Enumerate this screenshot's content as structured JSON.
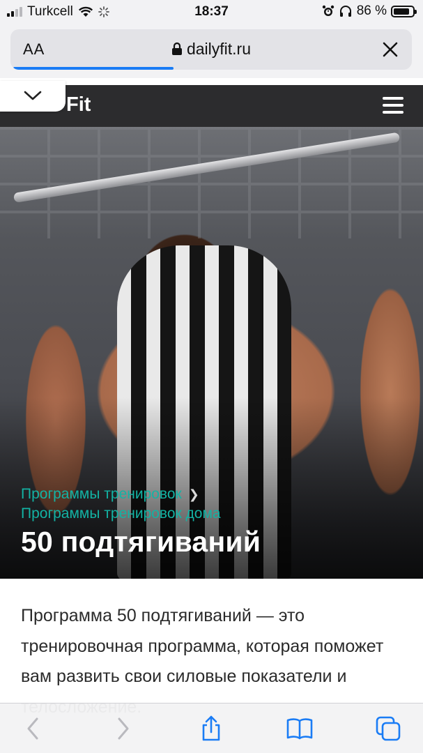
{
  "status_bar": {
    "carrier": "Turkcell",
    "time": "18:37",
    "battery_percent": "86 %",
    "battery_level": 0.86
  },
  "address_bar": {
    "text_size_label": "AA",
    "url": "dailyfit.ru",
    "load_progress": 0.4
  },
  "site_header": {
    "logo_text": "Fit"
  },
  "hero": {
    "breadcrumb_1": "Программы тренировок",
    "breadcrumb_2": "Программы тренировок дома",
    "title": "50 подтягиваний"
  },
  "article": {
    "text": "Программа 50 подтягиваний — это тренировочная программа, которая поможет вам развить свои силовые показатели и телосложение."
  },
  "colors": {
    "accent": "#13b3a4",
    "header_bg": "#2c2c2e",
    "toolbar_icon": "#1a7cf5"
  }
}
